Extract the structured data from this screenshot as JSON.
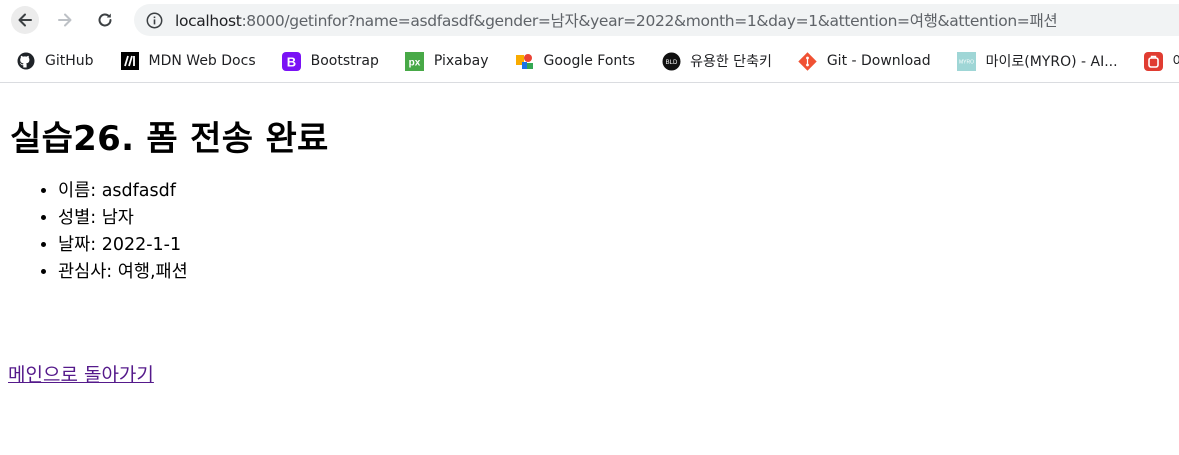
{
  "browser": {
    "url_host": "localhost",
    "url_rest": ":8000/getinfor?name=asdfasdf&gender=남자&year=2022&month=1&day=1&attention=여행&attention=패션"
  },
  "bookmarks": [
    {
      "label": "GitHub",
      "icon": "github-icon"
    },
    {
      "label": "MDN Web Docs",
      "icon": "mdn-icon"
    },
    {
      "label": "Bootstrap",
      "icon": "bootstrap-icon"
    },
    {
      "label": "Pixabay",
      "icon": "pixabay-icon"
    },
    {
      "label": "Google Fonts",
      "icon": "google-fonts-icon"
    },
    {
      "label": "유용한 단축키",
      "icon": "shortcut-icon"
    },
    {
      "label": "Git - Download",
      "icon": "git-icon"
    },
    {
      "label": "마이로(MYRO) - AI...",
      "icon": "myro-icon"
    },
    {
      "label": "여행",
      "icon": "travel-icon"
    }
  ],
  "page": {
    "title": "실습26. 폼 전송 완료",
    "items": [
      {
        "label": "이름:",
        "value": "asdfasdf"
      },
      {
        "label": "성별:",
        "value": "남자"
      },
      {
        "label": "날짜:",
        "value": "2022-1-1"
      },
      {
        "label": "관심사:",
        "value": "여행,패션"
      }
    ],
    "back_link": "메인으로 돌아가기"
  }
}
